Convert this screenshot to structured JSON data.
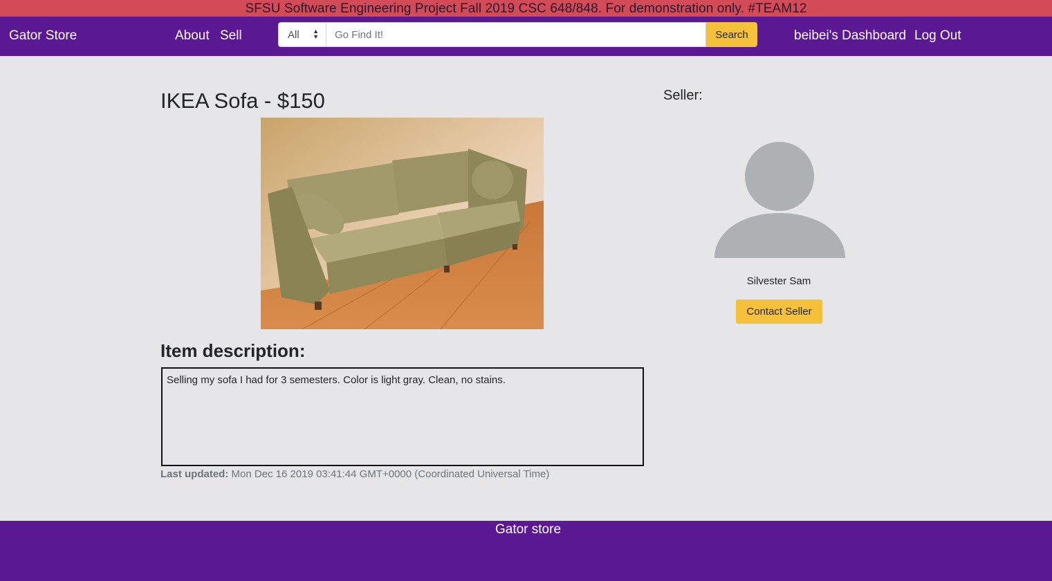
{
  "banner": {
    "text": "SFSU Software Engineering Project Fall 2019 CSC 648/848. For demonstration only. #TEAM12"
  },
  "navbar": {
    "brand": "Gator Store",
    "links": {
      "about": "About",
      "sell": "Sell",
      "dashboard": "beibei's Dashboard",
      "logout": "Log Out"
    },
    "search": {
      "category_selected": "All",
      "placeholder": "Go Find It!",
      "button": "Search"
    }
  },
  "listing": {
    "title": "IKEA Sofa - $150",
    "image_alt": "IKEA sofa photo",
    "description_heading": "Item description:",
    "description": "Selling my sofa I had for 3 semesters. Color is light gray. Clean, no stains.",
    "last_updated_label": "Last updated:",
    "last_updated_value": "Mon Dec 16 2019 03:41:44 GMT+0000 (Coordinated Universal Time)"
  },
  "seller": {
    "label": "Seller:",
    "name": "Silvester Sam",
    "contact_button": "Contact Seller"
  },
  "footer": {
    "text": "Gator store"
  },
  "colors": {
    "banner": "#d24b57",
    "nav_purple": "#5b1893",
    "accent_yellow": "#f5c03a",
    "page_bg": "#e6e5e7"
  }
}
